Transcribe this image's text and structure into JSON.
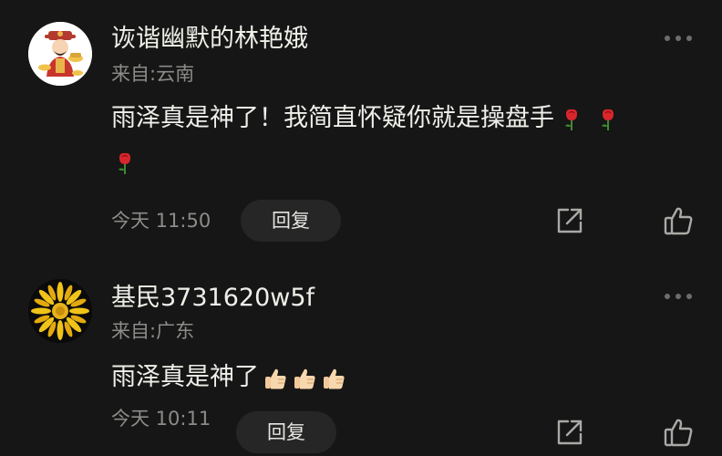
{
  "comments": [
    {
      "username": "诙谐幽默的林艳娥",
      "location": "来自:云南",
      "text": "雨泽真是神了！我简直怀疑你就是操盘手",
      "emoji_icons": [
        "rose-icon",
        "rose-icon",
        "rose-icon"
      ],
      "time": "今天 11:50",
      "reply_label": "回复",
      "avatar": "fortune-god-icon"
    },
    {
      "username": "基民3731620w5f",
      "location": "来自:广东",
      "text": "雨泽真是神了",
      "emoji_icons": [
        "thumbs-up-icon",
        "thumbs-up-icon",
        "thumbs-up-icon"
      ],
      "time": "今天 10:11",
      "reply_label": "回复",
      "avatar": "yellow-flower-icon"
    }
  ],
  "colors": {
    "background": "#161616",
    "text_primary": "#efefe9",
    "text_secondary": "#8b8b88",
    "reply_button_bg": "#262626"
  }
}
